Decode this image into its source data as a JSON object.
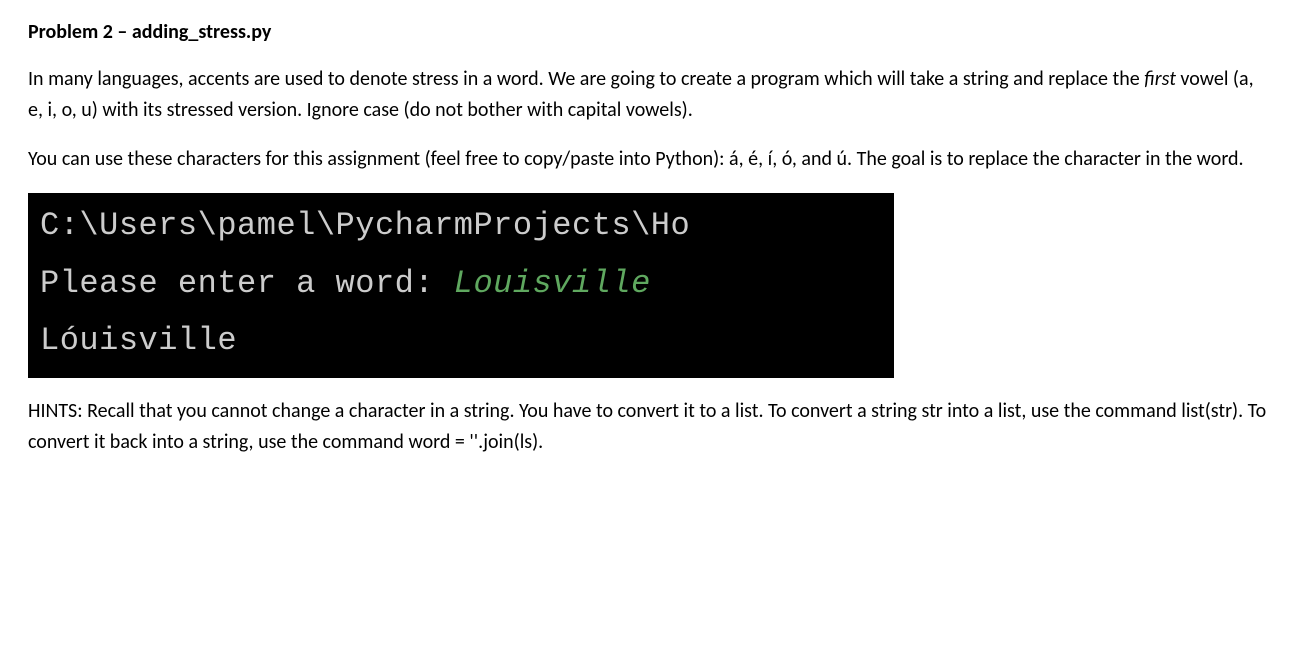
{
  "heading": "Problem 2 – adding_stress.py",
  "para1_part1": "In many languages, accents are used to denote stress in a word.  We are going to create a program which will take a string and replace the ",
  "para1_italic": "first",
  "para1_part2": " vowel (a, e, i, o, u) with its stressed version.  Ignore case (do not bother with capital vowels).",
  "para2": "You can use these characters for this assignment (feel free to copy/paste into Python): á, é, í, ó, and ú. The goal is to replace the character in the word.",
  "terminal": {
    "line1": "C:\\Users\\pamel\\PycharmProjects\\Ho",
    "line2_prompt": "Please enter a word: ",
    "line2_input": "Louisville",
    "line3": "Lóuisville"
  },
  "para3": "HINTS: Recall that you cannot change a character in a string.  You have to convert it to a list.  To convert a string str into a list, use the command list(str).  To convert it back into a string, use the command word = ''.join(ls)."
}
